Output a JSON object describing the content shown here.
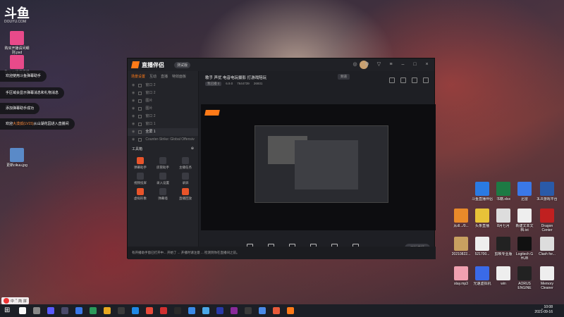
{
  "desktop_left": {
    "logo_text": "斗鱼",
    "logo_sub": "DOUYU.COM",
    "icons": [
      {
        "label": "购买开播请问细则.psd",
        "color": "#e84a8a"
      },
      {
        "label": "购买开播请问细则.psd",
        "color": "#e84a8a"
      },
      {
        "label": "更新cikuu.jpg",
        "color": "#5a8ac8"
      }
    ]
  },
  "notifications": [
    {
      "text": "欢迎使用斗鱼弹幕助手"
    },
    {
      "text": "手区域会显示弹幕消息和礼物消息"
    },
    {
      "text": "添加弹幕助手成功"
    },
    {
      "prefix": "欢迎",
      "highlight": "大漠孤(LV15)",
      "suffix": "从山湖花园进入直播间"
    }
  ],
  "window": {
    "app_title": "直播伴侣",
    "version_badge": "测试版",
    "left_tabs": [
      "场景设置",
      "互动",
      "直播",
      "特效面板"
    ],
    "scenes": [
      {
        "label": "窗口 2",
        "selected": false
      },
      {
        "label": "窗口 2",
        "selected": false
      },
      {
        "label": "图片",
        "selected": false
      },
      {
        "label": "图片",
        "selected": false
      },
      {
        "label": "窗口 2",
        "selected": false
      },
      {
        "label": "窗口 1",
        "selected": false
      },
      {
        "label": "全屏 1",
        "selected": true
      },
      {
        "label": "Counter-Strike: Global Offensive",
        "selected": false
      }
    ],
    "tools_header": "工具箱",
    "tools": [
      {
        "label": "弹幕助手",
        "orange": true
      },
      {
        "label": "房管助手",
        "orange": false
      },
      {
        "label": "主播任务",
        "orange": false
      },
      {
        "label": "视频投屏",
        "orange": false
      },
      {
        "label": "录入设置",
        "orange": false
      },
      {
        "label": "录屏",
        "orange": false
      },
      {
        "label": "虚拟形象",
        "orange": true
      },
      {
        "label": "弹幕墙",
        "orange": false
      },
      {
        "label": "直播回放",
        "orange": true
      }
    ],
    "room_title": "歌手 声优 电音电玩摄影 打游戏陪玩",
    "room_tag": "频道",
    "room_meta": [
      "我已播 0",
      "6.9.0",
      "7644739",
      "26931"
    ],
    "controls": [
      "直播屏幕",
      "摄像头",
      "手机投屏",
      "多媒体",
      "麦克风",
      "扬声器"
    ],
    "start_label": "开始直播",
    "status_text": "有开播助手窗已打开中...   开始了 ... 开播时请注意 ...   检测到你在直播间之前。"
  },
  "desktop_right": {
    "icons": [
      {
        "label": "斗鱼直播伴侣",
        "color": "#2a7ae2"
      },
      {
        "label": "书籍.xlsx",
        "color": "#1d7a44"
      },
      {
        "label": "迅雷",
        "color": "#3a78e8"
      },
      {
        "label": "3LR游戏平台",
        "color": "#2a5aa8"
      },
      {
        "label": "从dl.../0...",
        "color": "#e88a2a"
      },
      {
        "label": "头条直播",
        "color": "#e8c238"
      },
      {
        "label": "8月七月",
        "color": "#ddd"
      },
      {
        "label": "新建文本文档.txt",
        "color": "#eee"
      },
      {
        "label": "Dragon Center",
        "color": "#c02020"
      },
      {
        "label": "20210822...",
        "color": "#c8a060"
      },
      {
        "label": "521700...",
        "color": "#eee"
      },
      {
        "label": "剪映专业版",
        "color": "#222"
      },
      {
        "label": "Logitech G HUB",
        "color": "#111"
      },
      {
        "label": "Clash for...",
        "color": "#ddd"
      },
      {
        "label": "stay.mp3",
        "color": "#f0a0b0"
      },
      {
        "label": "光速虚拟机",
        "color": "#3a6ae8"
      },
      {
        "label": "win",
        "color": "#eee"
      },
      {
        "label": "AORUS ENGINE",
        "color": "#222"
      },
      {
        "label": "Memory Cleaner",
        "color": "#eee"
      }
    ]
  },
  "ime": {
    "labels": [
      "中",
      "°",
      "简",
      "拼"
    ]
  },
  "taskbar": {
    "items": [
      "#f8f8f8",
      "#888",
      "#5a5aff",
      "#4a4a6a",
      "#3a78e8",
      "#2a9a5a",
      "#e8a820",
      "#3a3a3a",
      "#1e88e5",
      "#e84a3a",
      "#d03030",
      "#2a2a2a",
      "#3a8ae8",
      "#4aa8e8",
      "#2a3aa8",
      "#8a2a9a",
      "#3a3a3a",
      "#4a8ae8",
      "#e85a3a",
      "#ff7a18"
    ],
    "tray": "^",
    "time": "10:08",
    "date": "2021-09-16"
  }
}
